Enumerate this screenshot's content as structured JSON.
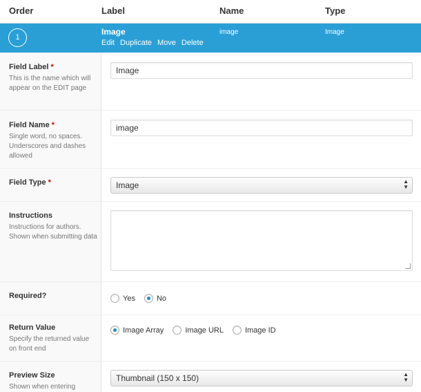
{
  "header": {
    "order": "Order",
    "label": "Label",
    "name": "Name",
    "type": "Type"
  },
  "field_row": {
    "order": "1",
    "label": "Image",
    "name": "image",
    "type": "Image",
    "actions": [
      "Edit",
      "Duplicate",
      "Move",
      "Delete"
    ]
  },
  "settings": {
    "field_label": {
      "label": "Field Label",
      "required_mark": "*",
      "desc": "This is the name which will appear on the EDIT page",
      "value": "Image"
    },
    "field_name": {
      "label": "Field Name",
      "required_mark": "*",
      "desc": "Single word, no spaces. Underscores and dashes allowed",
      "value": "image"
    },
    "field_type": {
      "label": "Field Type",
      "required_mark": "*",
      "value": "Image"
    },
    "instructions": {
      "label": "Instructions",
      "desc": "Instructions for authors. Shown when submitting data",
      "value": ""
    },
    "required": {
      "label": "Required?",
      "options": [
        "Yes",
        "No"
      ],
      "selected": "No"
    },
    "return_value": {
      "label": "Return Value",
      "desc": "Specify the returned value on front end",
      "options": [
        "Image Array",
        "Image URL",
        "Image ID"
      ],
      "selected": "Image Array"
    },
    "preview_size": {
      "label": "Preview Size",
      "desc": "Shown when entering",
      "value": "Thumbnail (150 x 150)"
    }
  },
  "colors": {
    "accent": "#2a9fd6",
    "required": "#cc0000",
    "radio_checked": "#1e8cbe"
  }
}
